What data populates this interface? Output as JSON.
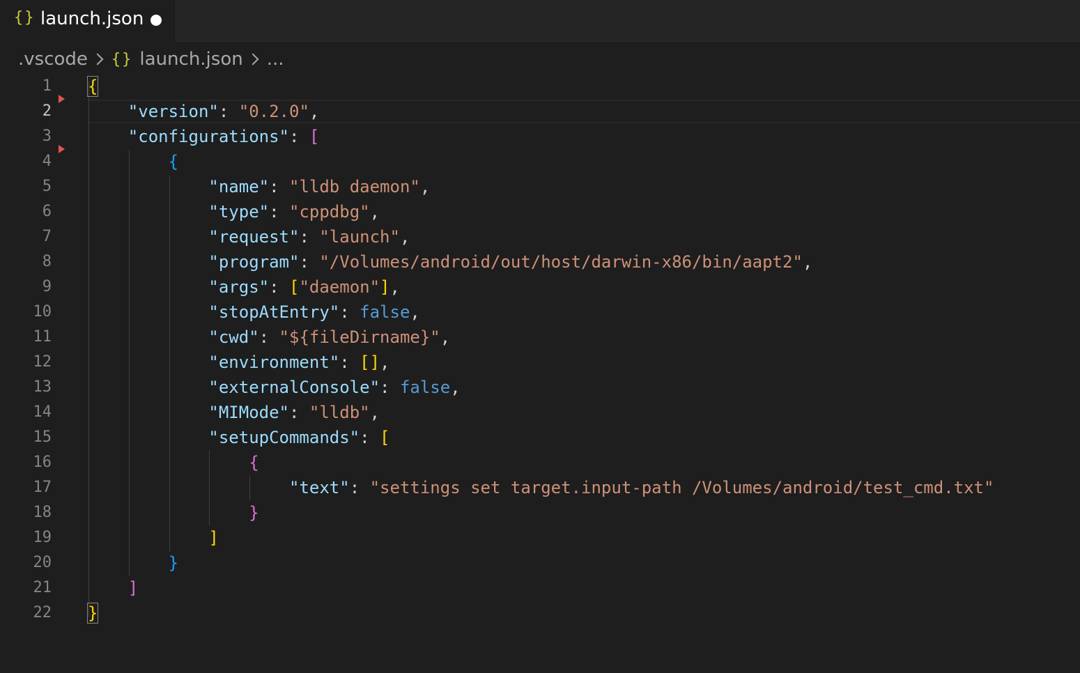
{
  "tab": {
    "icon": "{}",
    "label": "launch.json",
    "dirty": true
  },
  "breadcrumb": {
    "folder": ".vscode",
    "file_icon": "{}",
    "file": "launch.json",
    "more": "..."
  },
  "editor": {
    "active_line": 2,
    "lines": [
      {
        "n": "1"
      },
      {
        "n": "2"
      },
      {
        "n": "3"
      },
      {
        "n": "4"
      },
      {
        "n": "5"
      },
      {
        "n": "6"
      },
      {
        "n": "7"
      },
      {
        "n": "8"
      },
      {
        "n": "9"
      },
      {
        "n": "10"
      },
      {
        "n": "11"
      },
      {
        "n": "12"
      },
      {
        "n": "13"
      },
      {
        "n": "14"
      },
      {
        "n": "15"
      },
      {
        "n": "16"
      },
      {
        "n": "17"
      },
      {
        "n": "18"
      },
      {
        "n": "19"
      },
      {
        "n": "20"
      },
      {
        "n": "21"
      },
      {
        "n": "22"
      }
    ],
    "code": {
      "open_brace": "{",
      "version_key": "\"version\"",
      "version_val": "\"0.2.0\"",
      "configurations_key": "\"configurations\"",
      "name_key": "\"name\"",
      "name_val": "\"lldb daemon\"",
      "type_key": "\"type\"",
      "type_val": "\"cppdbg\"",
      "request_key": "\"request\"",
      "request_val": "\"launch\"",
      "program_key": "\"program\"",
      "program_val": "\"/Volumes/android/out/host/darwin-x86/bin/aapt2\"",
      "args_key": "\"args\"",
      "args_val": "\"daemon\"",
      "stopAtEntry_key": "\"stopAtEntry\"",
      "stopAtEntry_val": "false",
      "cwd_key": "\"cwd\"",
      "cwd_val": "\"${fileDirname}\"",
      "environment_key": "\"environment\"",
      "externalConsole_key": "\"externalConsole\"",
      "externalConsole_val": "false",
      "MIMode_key": "\"MIMode\"",
      "MIMode_val": "\"lldb\"",
      "setupCommands_key": "\"setupCommands\"",
      "text_key": "\"text\"",
      "text_val": "\"settings set target.input-path /Volumes/android/test_cmd.txt\"",
      "close_brace": "}"
    }
  }
}
